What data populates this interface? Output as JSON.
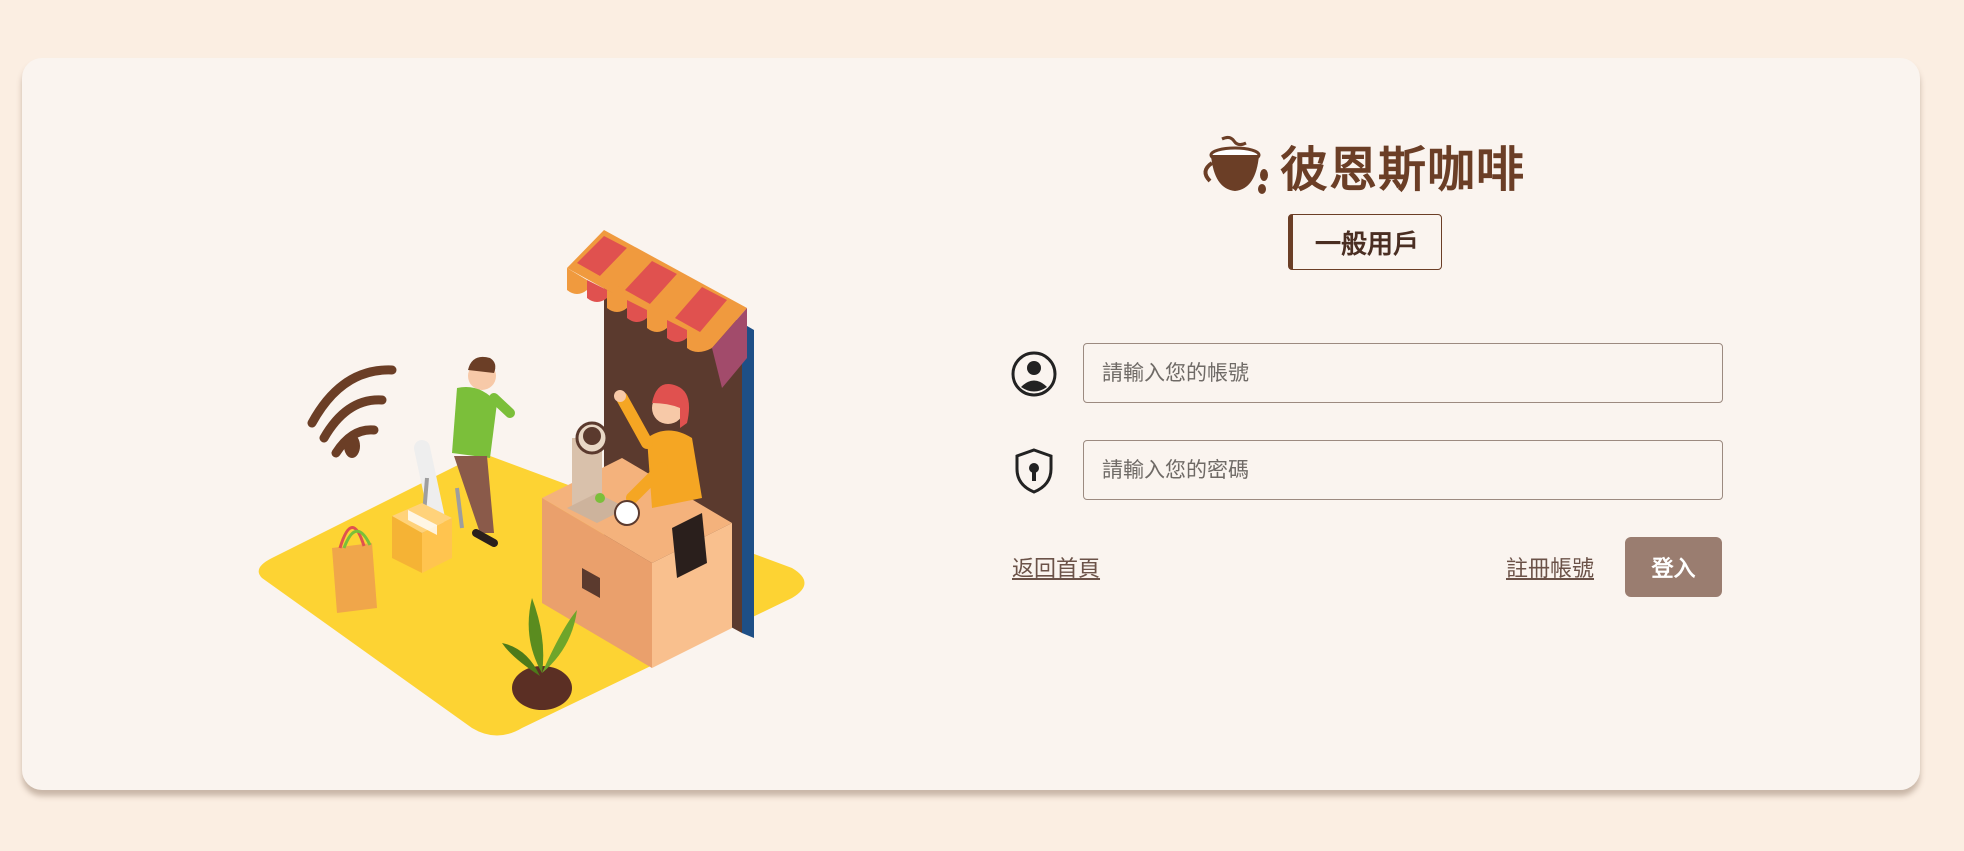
{
  "brand": {
    "name": "彼恩斯咖啡",
    "icon": "coffee-cup-icon",
    "color": "#6b3e26"
  },
  "role": {
    "label": "一般用戶"
  },
  "form": {
    "account": {
      "icon": "user-circle-icon",
      "value": "",
      "placeholder": "請輸入您的帳號"
    },
    "password": {
      "icon": "shield-keyhole-icon",
      "value": "",
      "placeholder": "請輸入您的密碼"
    }
  },
  "actions": {
    "back_home": "返回首頁",
    "register": "註冊帳號",
    "login": "登入",
    "login_color": "#9a7d70"
  },
  "colors": {
    "page_background": "#fbeee2",
    "card_background": "#faf4ef",
    "floor_yellow": "#fdd333",
    "awning_orange": "#f09a3e",
    "awning_red": "#e0514f"
  }
}
